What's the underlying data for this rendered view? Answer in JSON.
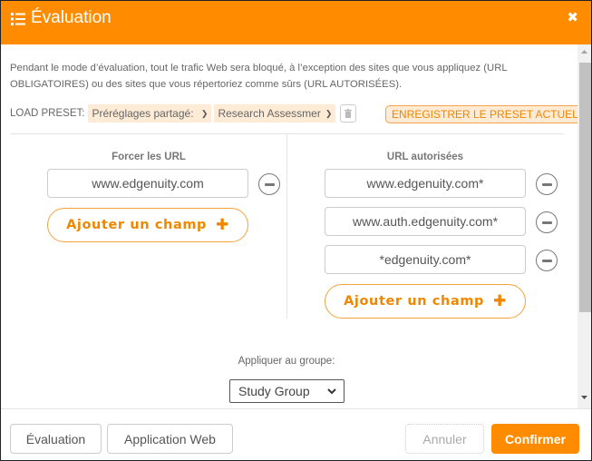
{
  "header": {
    "icon": "list-icon",
    "title": "Évaluation",
    "close_icon": "close-icon",
    "close_glyph": "✖"
  },
  "description": "Pendant le mode d’évaluation, tout le trafic Web sera bloqué, à l’exception des sites que vous appliquez (URL OBLIGATOIRES) ou des sites que vous répertoriez comme sûrs (URL AUTORISÉES).",
  "preset": {
    "label": "LOAD PRESET:",
    "source_selected": "Préréglages partagé:",
    "preset_selected": "Research Assessmer",
    "delete_icon": "trash-icon",
    "save_label": "ENREGISTRER LE PRESET ACTUEL"
  },
  "forced_urls": {
    "title": "Forcer les URL",
    "items": [
      "www.edgenuity.com"
    ],
    "add_label": "Ajouter un champ",
    "add_glyph": "✚"
  },
  "allowed_urls": {
    "title": "URL autorisées",
    "items": [
      "www.edgenuity.com*",
      "www.auth.edgenuity.com*",
      "*edgenuity.com*"
    ],
    "add_label": "Ajouter un champ",
    "add_glyph": "✚"
  },
  "group": {
    "label": "Appliquer au groupe:",
    "selected": "Study Group"
  },
  "footer": {
    "tab_evaluation": "Évaluation",
    "tab_web_app": "Application Web",
    "cancel": "Annuler",
    "confirm": "Confirmer"
  },
  "colors": {
    "accent": "#ff8c00",
    "accent_light": "#fdebd6"
  }
}
